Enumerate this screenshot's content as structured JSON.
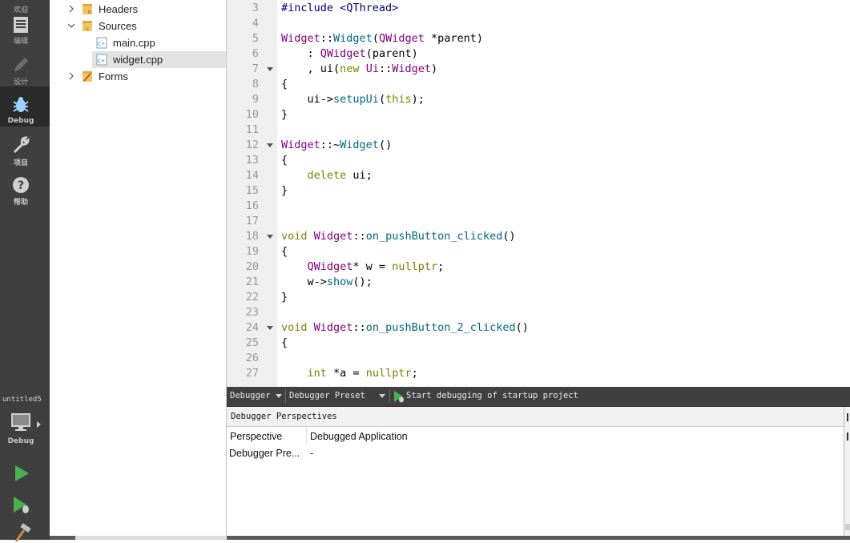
{
  "modebar": {
    "items": [
      {
        "label": "欢迎"
      },
      {
        "label": "编辑"
      },
      {
        "label": "设计"
      },
      {
        "label": "Debug"
      },
      {
        "label": "项目"
      },
      {
        "label": "帮助"
      }
    ],
    "kit": {
      "project": "untitled5",
      "mode": "Debug"
    }
  },
  "tree": {
    "items": [
      {
        "label": "Headers",
        "kind": "folder-headers",
        "expanded": false
      },
      {
        "label": "Sources",
        "kind": "folder-sources",
        "expanded": true
      },
      {
        "label": "main.cpp",
        "kind": "cpp-file"
      },
      {
        "label": "widget.cpp",
        "kind": "cpp-file",
        "selected": true
      },
      {
        "label": "Forms",
        "kind": "folder-forms",
        "expanded": false
      }
    ]
  },
  "editor": {
    "lines": [
      {
        "n": "3",
        "fold": false,
        "code": [
          [
            "pp",
            "#include <QThread>"
          ]
        ]
      },
      {
        "n": "4",
        "fold": false,
        "code": []
      },
      {
        "n": "5",
        "fold": false,
        "code": [
          [
            "cls",
            "Widget"
          ],
          [
            "",
            "::"
          ],
          [
            "fn",
            "Widget"
          ],
          [
            "",
            "("
          ],
          [
            "cls",
            "QWidget"
          ],
          [
            "",
            " *parent)"
          ]
        ]
      },
      {
        "n": "6",
        "fold": false,
        "code": [
          [
            "",
            "    : "
          ],
          [
            "cls",
            "QWidget"
          ],
          [
            "",
            "(parent)"
          ]
        ]
      },
      {
        "n": "7",
        "fold": true,
        "code": [
          [
            "",
            "    , ui("
          ],
          [
            "kw",
            "new"
          ],
          [
            "",
            " "
          ],
          [
            "cls",
            "Ui"
          ],
          [
            "",
            "::"
          ],
          [
            "cls",
            "Widget"
          ],
          [
            "",
            ")"
          ]
        ]
      },
      {
        "n": "8",
        "fold": false,
        "code": [
          [
            "",
            "{"
          ]
        ]
      },
      {
        "n": "9",
        "fold": false,
        "code": [
          [
            "",
            "    ui->"
          ],
          [
            "fn",
            "setupUi"
          ],
          [
            "",
            "("
          ],
          [
            "kw",
            "this"
          ],
          [
            "",
            ");"
          ]
        ]
      },
      {
        "n": "10",
        "fold": false,
        "code": [
          [
            "",
            "}"
          ]
        ]
      },
      {
        "n": "11",
        "fold": false,
        "code": []
      },
      {
        "n": "12",
        "fold": true,
        "code": [
          [
            "cls",
            "Widget"
          ],
          [
            "",
            "::~"
          ],
          [
            "fn",
            "Widget"
          ],
          [
            "",
            "()"
          ]
        ]
      },
      {
        "n": "13",
        "fold": false,
        "code": [
          [
            "",
            "{"
          ]
        ]
      },
      {
        "n": "14",
        "fold": false,
        "code": [
          [
            "",
            "    "
          ],
          [
            "kw",
            "delete"
          ],
          [
            "",
            " ui;"
          ]
        ]
      },
      {
        "n": "15",
        "fold": false,
        "code": [
          [
            "",
            "}"
          ]
        ]
      },
      {
        "n": "16",
        "fold": false,
        "code": []
      },
      {
        "n": "17",
        "fold": false,
        "code": []
      },
      {
        "n": "18",
        "fold": true,
        "code": [
          [
            "kw",
            "void"
          ],
          [
            "",
            " "
          ],
          [
            "cls",
            "Widget"
          ],
          [
            "",
            "::"
          ],
          [
            "fn",
            "on_pushButton_clicked"
          ],
          [
            "",
            "()"
          ]
        ]
      },
      {
        "n": "19",
        "fold": false,
        "code": [
          [
            "",
            "{"
          ]
        ]
      },
      {
        "n": "20",
        "fold": false,
        "code": [
          [
            "",
            "    "
          ],
          [
            "cls",
            "QWidget"
          ],
          [
            "",
            "* w = "
          ],
          [
            "kw",
            "nullptr"
          ],
          [
            "",
            ";"
          ]
        ]
      },
      {
        "n": "21",
        "fold": false,
        "code": [
          [
            "",
            "    w->"
          ],
          [
            "fn",
            "show"
          ],
          [
            "",
            "();"
          ]
        ]
      },
      {
        "n": "22",
        "fold": false,
        "code": [
          [
            "",
            "}"
          ]
        ]
      },
      {
        "n": "23",
        "fold": false,
        "code": []
      },
      {
        "n": "24",
        "fold": true,
        "code": [
          [
            "kw",
            "void"
          ],
          [
            "",
            " "
          ],
          [
            "cls",
            "Widget"
          ],
          [
            "",
            "::"
          ],
          [
            "fn",
            "on_pushButton_2_clicked"
          ],
          [
            "",
            "()"
          ]
        ]
      },
      {
        "n": "25",
        "fold": false,
        "code": [
          [
            "",
            "{"
          ]
        ]
      },
      {
        "n": "26",
        "fold": false,
        "code": []
      },
      {
        "n": "27",
        "fold": false,
        "code": [
          [
            "",
            "    "
          ],
          [
            "kw",
            "int"
          ],
          [
            "",
            " *a = "
          ],
          [
            "kw",
            "nullptr"
          ],
          [
            "",
            ";"
          ]
        ]
      }
    ]
  },
  "debugger_toolbar": {
    "engine": "Debugger",
    "preset": "Debugger Preset",
    "start_label": "Start debugging of startup project"
  },
  "perspectives": {
    "title": "Debugger Perspectives",
    "rows": [
      {
        "key": "Perspective",
        "value": "Debugged Application"
      },
      {
        "key": "Debugger Pre...",
        "value": "-"
      }
    ]
  },
  "colors": {
    "modebar_bg": "#3f3f3f",
    "keyword": "#808000",
    "type": "#800080",
    "function": "#00677c",
    "preprocessor": "#000080",
    "run_green": "#4caf50"
  }
}
